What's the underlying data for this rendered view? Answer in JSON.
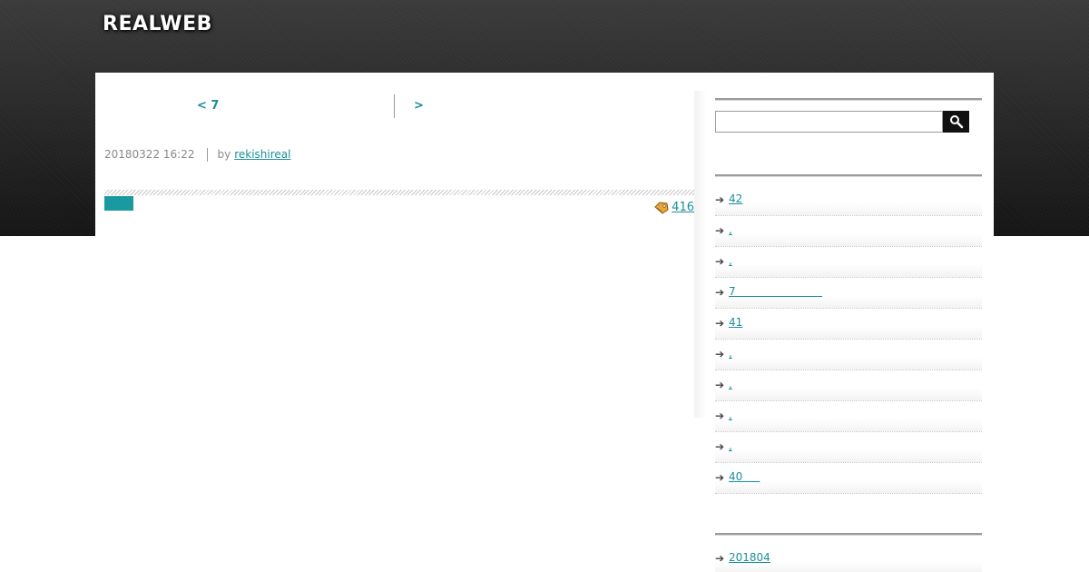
{
  "header": {
    "site_title": "REALWEB"
  },
  "post_nav": {
    "prev_label": "< 7",
    "next_label": ">"
  },
  "post_meta": {
    "date": "20180322 16:22",
    "by_label": "by",
    "author": "rekishireal"
  },
  "tags": {
    "count": "416"
  },
  "sidebar": {
    "search": {
      "value": "",
      "placeholder": ""
    },
    "recent_posts": [
      "42",
      ",",
      ",",
      "7                         ",
      "41",
      ",",
      ",",
      ",",
      ",",
      "40     "
    ],
    "archives": [
      "201804"
    ]
  },
  "colors": {
    "accent": "#1a8f99",
    "tag_block": "#1a9aa0",
    "header_dark": "#141414"
  },
  "icons": {
    "tag": "tag-icon",
    "search": "search-icon",
    "arrow": "arrow-right-icon"
  }
}
